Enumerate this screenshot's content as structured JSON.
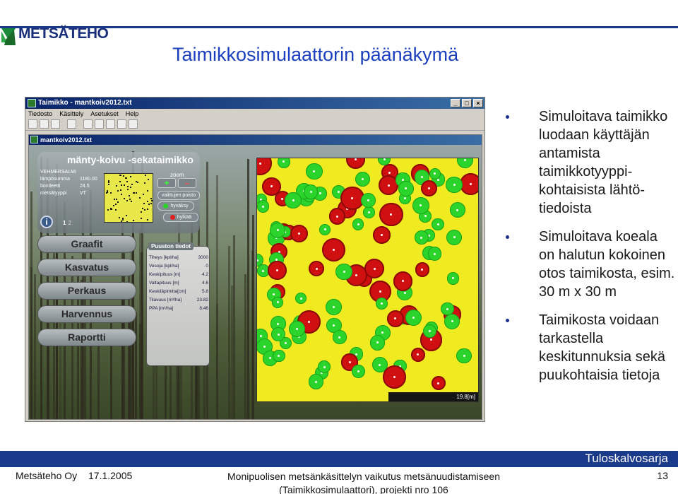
{
  "slide": {
    "logo_text": "METSÄTEHO",
    "title": "Taimikkosimulaattorin päänäkymä",
    "bullets": [
      "Simuloitava taimikko luodaan käyttäjän antamis­ta taimikkotyyppi­kohtaisista lähtö­tiedoista",
      "Simuloitava koe­ala on halutun kokoinen otos taimikosta, esim. 30 m x 30 m",
      "Taimikosta voi­daan tarkastella keskitunnuksia sekä puukohtaisia tietoja"
    ],
    "footer_tag": "Tuloskalvosarja",
    "footer_org": "Metsäteho Oy",
    "footer_date": "17.1.2005",
    "footer_project_line1": "Monipuolisen metsänkäsittelyn vaikutus metsänuudistamiseen",
    "footer_project_line2": "(Taimikkosimulaattori), projekti nro 106",
    "page_number": "13",
    "colors": {
      "brand_blue": "#1a3a8c",
      "title_blue": "#1b3fbf"
    }
  },
  "app": {
    "window_title": "Taimikko - mantkoiv2012.txt",
    "menu": [
      "Tiedosto",
      "Käsittely",
      "Asetukset",
      "Help"
    ],
    "toolbar_icons": [
      "new-icon",
      "open-icon",
      "save-icon",
      "print-icon",
      "cut-icon",
      "copy-icon",
      "paste-icon",
      "undo-icon",
      "close-icon"
    ],
    "inner_title": "mantkoiv2012.txt",
    "stand_title": "mänty-koivu -sekataimikko",
    "stand_info": [
      {
        "key": "VEHMERSALMI",
        "value": ""
      },
      {
        "key": "lämpösumma",
        "value": "1180.00"
      },
      {
        "key": "boniteetti",
        "value": "24.5"
      },
      {
        "key": "metsätyyppi",
        "value": "VT"
      }
    ],
    "zoom_label": "zoom",
    "zoom_in": "+",
    "zoom_out": "–",
    "selected_trees_remove": "valittujen poisto",
    "accept": "hyväksy",
    "reject": "hylkää",
    "info_icon": "i",
    "pages": [
      "1",
      "2"
    ],
    "nav_buttons": [
      "Graafit",
      "Kasvatus",
      "Perkaus",
      "Harvennus",
      "Raportti"
    ],
    "stats_title": "Puuston tiedot",
    "stats": [
      {
        "label": "Tiheys [kpl/ha]",
        "value": "3000"
      },
      {
        "label": "Vesoja [kpl/ha]",
        "value": "0"
      },
      {
        "label": "Keskipituus [m]",
        "value": "4.2"
      },
      {
        "label": "Valtapituus [m]",
        "value": "4.6"
      },
      {
        "label": "Keskiläpimitta[cm]",
        "value": "5.8"
      },
      {
        "label": "Tilavuus [m³/ha]",
        "value": "23.82"
      },
      {
        "label": "PPA [m²/ha]",
        "value": "8.46"
      }
    ],
    "scale_label": "19.8[m]",
    "colors": {
      "plot": "#f0ea20",
      "pine": "#2bd42b",
      "birch": "#d01010"
    }
  }
}
